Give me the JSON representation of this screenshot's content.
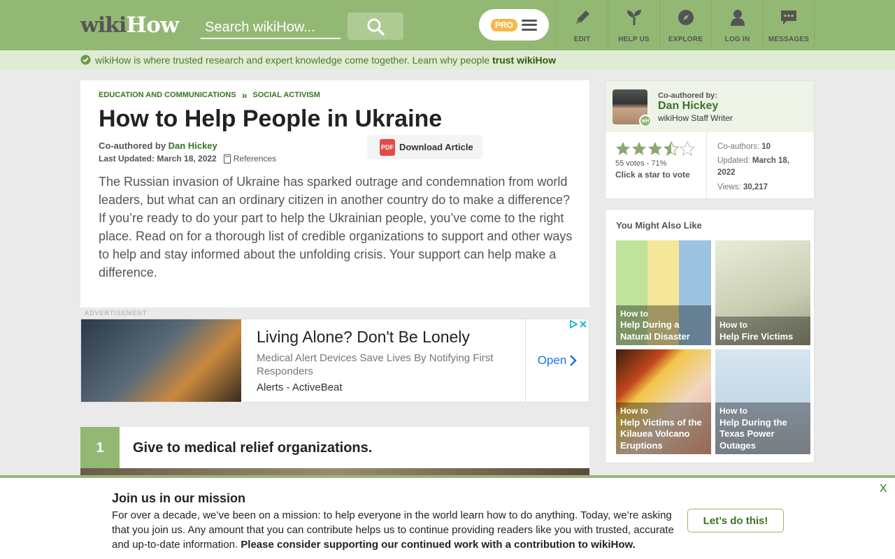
{
  "header": {
    "logo_wiki": "wiki",
    "logo_how": "How",
    "search_placeholder": "Search wikiHow...",
    "pro_label": "PRO",
    "nav": [
      {
        "label": "EDIT",
        "icon": "pencil-icon"
      },
      {
        "label": "HELP US",
        "icon": "sprout-icon"
      },
      {
        "label": "EXPLORE",
        "icon": "compass-icon"
      },
      {
        "label": "LOG IN",
        "icon": "user-icon"
      },
      {
        "label": "MESSAGES",
        "icon": "chat-icon"
      }
    ],
    "accent": "#93b874"
  },
  "trust_bar": {
    "text": "wikiHow is where trusted research and expert knowledge come together. Learn why people ",
    "link": "trust wikiHow"
  },
  "article": {
    "breadcrumbs": [
      "EDUCATION AND COMMUNICATIONS",
      "SOCIAL ACTIVISM"
    ],
    "breadcrumb_sep": "»",
    "title": "How to Help People in Ukraine",
    "coauthored_label": "Co-authored by ",
    "author": "Dan Hickey",
    "updated_label": "Last Updated: March 18, 2022",
    "references": "References",
    "download_label": "Download Article",
    "pdf_text": "PDF",
    "intro": "The Russian invasion of Ukraine has sparked outrage and condemnation from world leaders, but what can an ordinary citizen in another country do to make a difference? If you’re ready to do your part to help the Ukrainian people, you’ve come to the right place. Read on for a thorough list of credible organizations to support and other ways to help and stay informed about the unfolding crisis. Your support can help make a difference."
  },
  "ad": {
    "label": "ADVERTISEMENT",
    "title": "Living Alone? Don't Be Lonely",
    "description": "Medical Alert Devices Save Lives By Notifying First Responders",
    "source": "Alerts - ActiveBeat",
    "open_label": "Open"
  },
  "step": {
    "number": "1",
    "title": "Give to medical relief organizations."
  },
  "author_card": {
    "coauthored_label": "Co-authored by:",
    "name": "Dan Hickey",
    "role": "wikiHow Staff Writer",
    "badge": "wH",
    "rating_stars": 3.5,
    "votes": "55 votes - 71%",
    "vote_cta": "Click a star to vote",
    "coauthors_label": "Co-authors: ",
    "coauthors_value": "10",
    "updated_label": "Updated: ",
    "updated_value": "March 18, 2022",
    "views_label": "Views: ",
    "views_value": "30,217"
  },
  "related": {
    "title": "You Might Also Like",
    "items": [
      {
        "howto": "How to",
        "title": "Help During a Natural Disaster"
      },
      {
        "howto": "How to",
        "title": "Help Fire Victims"
      },
      {
        "howto": "How to",
        "title": "Help Victims of the Kilauea Volcano Eruptions"
      },
      {
        "howto": "How to",
        "title": "Help During the Texas Power Outages"
      }
    ]
  },
  "banner": {
    "title": "Join us in our mission",
    "body": "For over a decade, we’ve been on a mission: to help everyone in the world learn how to do anything. Today, we’re asking that you join us. Any amount that you can contribute helps us to continue providing readers like you with trusted, accurate and up-to-date information. ",
    "body_bold": "Please consider supporting our continued work with a contribution to wikiHow.",
    "cta": "Let’s do this!",
    "close": "X"
  }
}
